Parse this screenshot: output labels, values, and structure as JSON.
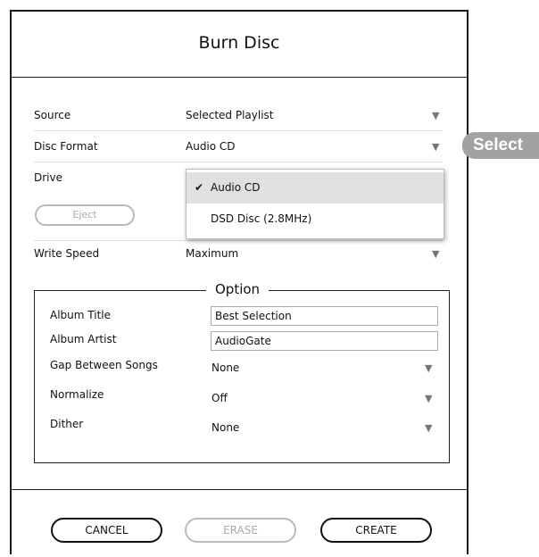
{
  "dialog": {
    "title": "Burn Disc"
  },
  "rows": {
    "source": {
      "label": "Source",
      "value": "Selected Playlist"
    },
    "disc_format": {
      "label": "Disc Format",
      "value": "Audio CD"
    },
    "drive": {
      "label": "Drive",
      "eject_label": "Eject"
    },
    "write_speed": {
      "label": "Write Speed",
      "value": "Maximum"
    }
  },
  "dropdown": {
    "items": [
      {
        "label": "Audio CD",
        "check": "✔",
        "selected": true
      },
      {
        "label": "DSD Disc (2.8MHz)",
        "selected": false
      }
    ]
  },
  "callout": {
    "label": "Select"
  },
  "option": {
    "legend": "Option",
    "album_title": {
      "label": "Album Title",
      "value": "Best Selection"
    },
    "album_artist": {
      "label": "Album Artist",
      "value": "AudioGate"
    },
    "gap": {
      "label": "Gap Between Songs",
      "value": "None"
    },
    "normalize": {
      "label": "Normalize",
      "value": "Off"
    },
    "dither": {
      "label": "Dither",
      "value": "None"
    }
  },
  "buttons": {
    "cancel": "CANCEL",
    "erase": "ERASE",
    "create": "CREATE"
  },
  "icons": {
    "dropdown_arrow": "▼"
  }
}
